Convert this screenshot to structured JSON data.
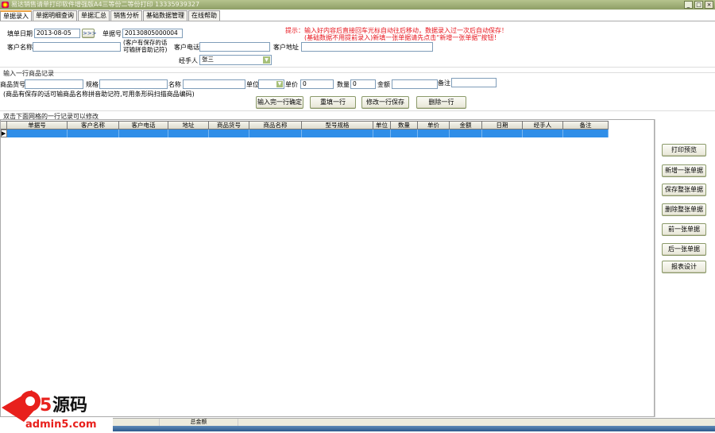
{
  "window": {
    "title": "易达销售请单打印软件增强版A4三等份二等份打印 13335939327",
    "min": "_",
    "max": "□",
    "close": "×"
  },
  "tabs": [
    "单据录入",
    "单据明细查询",
    "单据汇总",
    "销售分析",
    "基础数据管理",
    "在线帮助"
  ],
  "header": {
    "date_label": "填单日期",
    "date_value": "2013-08-05",
    "date_btn": ">>>",
    "doc_no_label": "单据号",
    "doc_no_value": "20130805000004",
    "customer_label": "客户名称",
    "customer_value": "",
    "customer_hint1": "(客户有保存的话",
    "customer_hint2": "可输拼音助记符)",
    "phone_label": "客户电话",
    "phone_value": "",
    "address_label": "客户地址",
    "address_value": "",
    "handler_label": "经手人",
    "handler_value": "张三",
    "tip1": "提示：输入好内容后直接回车光标自动往后移动，数据录入过一次后自动保存！",
    "tip2": "(基础数据不用提前录入)新填一张单据请先点击“新增一张单据”按钮！"
  },
  "item": {
    "section": "输入一行商品记录",
    "code_label": "商品货号",
    "spec_label": "规格",
    "name_label": "名称",
    "unit_label": "单位",
    "price_label": "单价",
    "price_value": "0",
    "qty_label": "数量",
    "qty_value": "0",
    "amount_label": "金额",
    "note_label": "备注",
    "hint": "(商品有保存的话可输商品名称拼音助记符,可用条形码扫描商品编码)",
    "buttons": [
      "输入完一行确定",
      "重填一行",
      "修改一行保存",
      "删除一行"
    ]
  },
  "grid": {
    "caption": "双击下面网格的一行记录可以修改",
    "columns": [
      "单据号",
      "客户名称",
      "客户电话",
      "地址",
      "商品货号",
      "商品名称",
      "型号规格",
      "单位",
      "数量",
      "单价",
      "金额",
      "日期",
      "经手人",
      "备注"
    ],
    "selected_color": "#2f8ee8"
  },
  "side_buttons": [
    "打印预览",
    "新增一张单据",
    "保存整张单据",
    "删除整张单据",
    "前一张单据",
    "后一张单据",
    "报表设计"
  ],
  "status": {
    "total_label": "总金额"
  },
  "logo": {
    "text1": "源码",
    "text2": "admin5.com"
  }
}
